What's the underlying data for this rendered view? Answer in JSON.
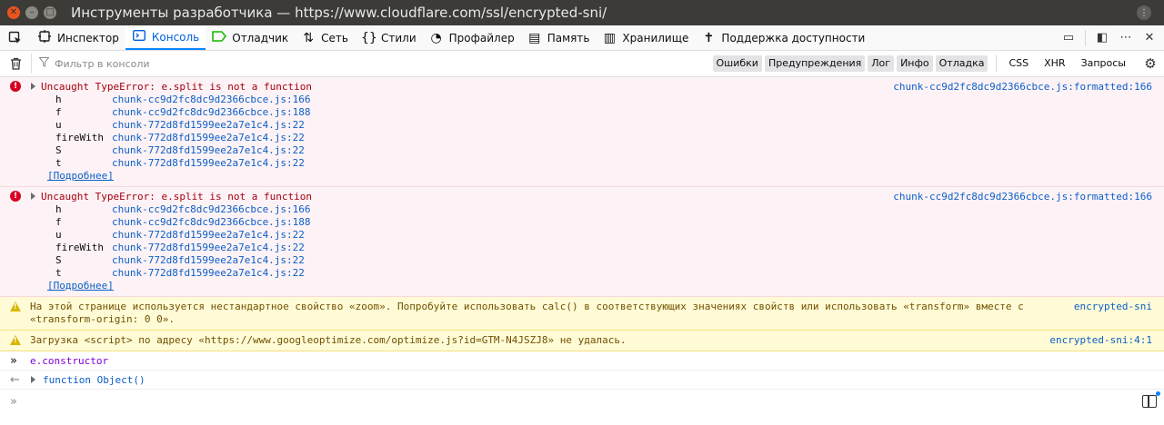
{
  "window": {
    "title": "Инструменты разработчика — https://www.cloudflare.com/ssl/encrypted-sni/"
  },
  "toolbar": {
    "tabs": [
      {
        "label": "Инспектор",
        "icon": "inspector-icon"
      },
      {
        "label": "Консоль",
        "icon": "console-icon",
        "active": true
      },
      {
        "label": "Отладчик",
        "icon": "debugger-icon"
      },
      {
        "label": "Сеть",
        "icon": "network-icon"
      },
      {
        "label": "Стили",
        "icon": "style-editor-icon"
      },
      {
        "label": "Профайлер",
        "icon": "profiler-icon"
      },
      {
        "label": "Память",
        "icon": "memory-icon"
      },
      {
        "label": "Хранилище",
        "icon": "storage-icon"
      },
      {
        "label": "Поддержка доступности",
        "icon": "accessibility-icon"
      }
    ]
  },
  "filterbar": {
    "placeholder": "Фильтр в консоли",
    "toggles": [
      "Ошибки",
      "Предупреждения",
      "Лог",
      "Инфо",
      "Отладка"
    ],
    "extra": [
      "CSS",
      "XHR",
      "Запросы"
    ]
  },
  "console": {
    "errors": [
      {
        "message": "Uncaught TypeError: e.split is not a function",
        "location": "chunk-cc9d2fc8dc9d2366cbce.js:formatted:166",
        "frames": [
          {
            "fn": "h",
            "file": "chunk-cc9d2fc8dc9d2366cbce.js:166"
          },
          {
            "fn": "f",
            "file": "chunk-cc9d2fc8dc9d2366cbce.js:188"
          },
          {
            "fn": "u",
            "file": "chunk-772d8fd1599ee2a7e1c4.js:22"
          },
          {
            "fn": "fireWith",
            "file": "chunk-772d8fd1599ee2a7e1c4.js:22"
          },
          {
            "fn": "S",
            "file": "chunk-772d8fd1599ee2a7e1c4.js:22"
          },
          {
            "fn": "t",
            "file": "chunk-772d8fd1599ee2a7e1c4.js:22"
          }
        ],
        "more": "[Подробнее]"
      },
      {
        "message": "Uncaught TypeError: e.split is not a function",
        "location": "chunk-cc9d2fc8dc9d2366cbce.js:formatted:166",
        "frames": [
          {
            "fn": "h",
            "file": "chunk-cc9d2fc8dc9d2366cbce.js:166"
          },
          {
            "fn": "f",
            "file": "chunk-cc9d2fc8dc9d2366cbce.js:188"
          },
          {
            "fn": "u",
            "file": "chunk-772d8fd1599ee2a7e1c4.js:22"
          },
          {
            "fn": "fireWith",
            "file": "chunk-772d8fd1599ee2a7e1c4.js:22"
          },
          {
            "fn": "S",
            "file": "chunk-772d8fd1599ee2a7e1c4.js:22"
          },
          {
            "fn": "t",
            "file": "chunk-772d8fd1599ee2a7e1c4.js:22"
          }
        ],
        "more": "[Подробнее]"
      }
    ],
    "warnings": [
      {
        "message": "На этой странице используется нестандартное свойство «zoom». Попробуйте использовать calc() в соответствующих значениях свойств или использовать «transform» вместе с «transform-origin: 0 0».",
        "location": "encrypted-sni"
      },
      {
        "message": "Загрузка <script> по адресу «https://www.googleoptimize.com/optimize.js?id=GTM-N4JSZJ8» не удалась.",
        "location": "encrypted-sni:4:1"
      }
    ],
    "input": "e.constructor",
    "result": "function Object()"
  }
}
